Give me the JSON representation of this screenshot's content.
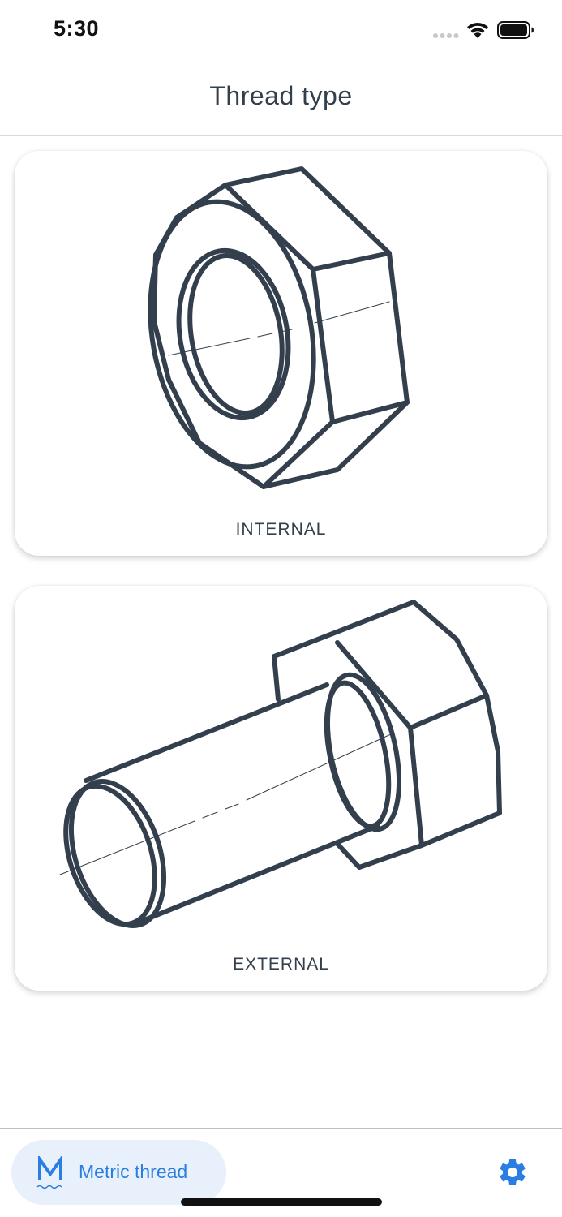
{
  "status_bar": {
    "time": "5:30"
  },
  "header": {
    "title": "Thread type"
  },
  "cards": [
    {
      "label": "INTERNAL",
      "icon": "hex-nut-icon"
    },
    {
      "label": "EXTERNAL",
      "icon": "hex-bolt-icon"
    }
  ],
  "bottom_bar": {
    "mode_label": "Metric thread",
    "mode_icon": "metric-m-icon",
    "settings_icon": "gear-icon"
  },
  "colors": {
    "ink": "#333f4c",
    "accent": "#2a7ee2",
    "chip_bg": "#e7f0fb"
  }
}
